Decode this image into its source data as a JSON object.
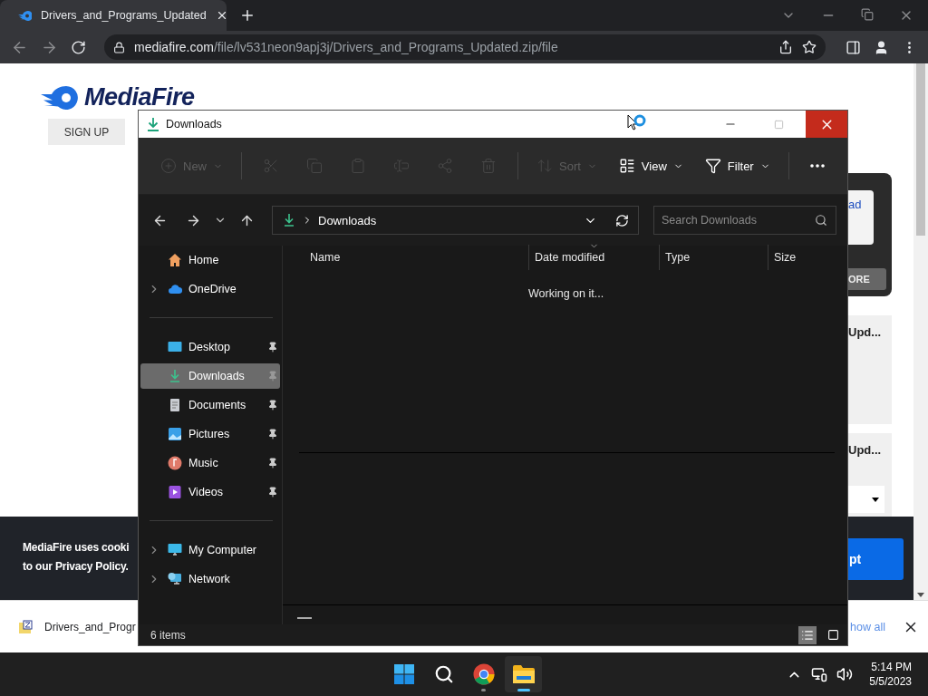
{
  "browser": {
    "tab": {
      "title": "Drivers_and_Programs_Updated"
    },
    "url": {
      "domain": "mediafire.com",
      "path": "/file/lv531neon9apj3j/Drivers_and_Programs_Updated.zip/file"
    }
  },
  "page": {
    "logo": "MediaFire",
    "sign_up": "SIGN UP",
    "side": {
      "link": "ad",
      "more": "ORE",
      "card_titles": [
        "Upd...",
        "Upd..."
      ]
    }
  },
  "cookie_banner": {
    "line_1": "MediaFire uses cooki",
    "line_2": "to our Privacy Policy.",
    "accept": "pt"
  },
  "download_bar": {
    "file": "Drivers_and_Progr",
    "show_all": "how all"
  },
  "explorer": {
    "title": "Downloads",
    "toolbar": [
      {
        "kind": "new",
        "label": "New",
        "disabled": true
      },
      {
        "kind": "cut",
        "disabled": true
      },
      {
        "kind": "copy",
        "disabled": true
      },
      {
        "kind": "paste",
        "disabled": true
      },
      {
        "kind": "rename",
        "disabled": true
      },
      {
        "kind": "share",
        "disabled": true
      },
      {
        "kind": "delete",
        "disabled": true
      },
      {
        "kind": "sort",
        "label": "Sort",
        "disabled": true
      },
      {
        "kind": "view",
        "label": "View",
        "disabled": false
      },
      {
        "kind": "filter",
        "label": "Filter",
        "disabled": false
      },
      {
        "kind": "more",
        "disabled": false
      }
    ],
    "address": "Downloads",
    "search": {
      "placeholder": "Search Downloads"
    },
    "nav_groups": [
      [
        {
          "label": "Home",
          "kind": "home",
          "expandable": false,
          "pinned": false,
          "selected": false
        },
        {
          "label": "OneDrive",
          "kind": "cloud",
          "expandable": true,
          "pinned": false,
          "selected": false
        }
      ],
      [
        {
          "label": "Desktop",
          "kind": "desktop",
          "expandable": false,
          "pinned": true,
          "selected": false
        },
        {
          "label": "Downloads",
          "kind": "download",
          "expandable": false,
          "pinned": true,
          "selected": true
        },
        {
          "label": "Documents",
          "kind": "document",
          "expandable": false,
          "pinned": true,
          "selected": false
        },
        {
          "label": "Pictures",
          "kind": "pictures",
          "expandable": false,
          "pinned": true,
          "selected": false
        },
        {
          "label": "Music",
          "kind": "music",
          "expandable": false,
          "pinned": true,
          "selected": false
        },
        {
          "label": "Videos",
          "kind": "videos",
          "expandable": false,
          "pinned": true,
          "selected": false
        }
      ],
      [
        {
          "label": "My Computer",
          "kind": "computer",
          "expandable": true,
          "pinned": false,
          "selected": false
        },
        {
          "label": "Network",
          "kind": "network",
          "expandable": true,
          "pinned": false,
          "selected": false
        }
      ]
    ],
    "columns": [
      "Name",
      "Date modified",
      "Type",
      "Size"
    ],
    "status": "Working on it...",
    "item_count": "6 items",
    "views": [
      {
        "kind": "details",
        "selected": true
      },
      {
        "kind": "tiles",
        "selected": false
      }
    ]
  },
  "taskbar": {
    "apps": [
      {
        "kind": "start",
        "active": false
      },
      {
        "kind": "search",
        "active": false
      },
      {
        "kind": "chrome",
        "active": false
      },
      {
        "kind": "files",
        "active": true
      }
    ],
    "time": "5:14 PM",
    "date": "5/5/2023"
  }
}
